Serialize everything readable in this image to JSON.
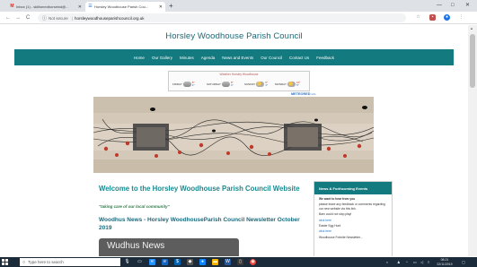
{
  "browser": {
    "tabs": [
      {
        "title": "Inbox (1) - skillsmedhorseind@...",
        "icon": "gmail-icon"
      },
      {
        "title": "Horsley Woodhouse Parish Cou...",
        "icon": "site-icon"
      }
    ],
    "new_tab": "+",
    "window_controls": {
      "minimize": "—",
      "maximize": "□",
      "close": "✕"
    },
    "nav": {
      "back": "←",
      "forward": "→",
      "reload": "C"
    },
    "address": {
      "security": "Not secure",
      "url": "horsleywoodhouseparishcouncil.org.uk"
    }
  },
  "site": {
    "title": "Horsley Woodhouse Parish Council",
    "nav": [
      "Home",
      "Our Gallery",
      "Minutes",
      "Agenda",
      "News and Events",
      "Our Council",
      "Contact Us",
      "Feedback"
    ]
  },
  "weather": {
    "title": "Weather Horsley Woodhouse",
    "days": [
      {
        "name": "FRIDAY",
        "hi": "8°",
        "lo": "4°"
      },
      {
        "name": "SATURDAY",
        "hi": "8°",
        "lo": "4°"
      },
      {
        "name": "SUNDAY",
        "hi": "6°",
        "lo": "1°"
      },
      {
        "name": "MONDAY",
        "hi": "10°",
        "lo": "5°"
      }
    ],
    "brand": "METEORED",
    "brand_suffix": "info"
  },
  "main": {
    "welcome": "Welcome to the Horsley Woodhouse Parish Council Website",
    "motto": "\"taking care of our local community\"",
    "news_heading": "Woodhus News - Horsley WoodhouseParish Council Newsletter October 2019",
    "news_image_text": "Wudhus News"
  },
  "sidebar": {
    "title": "News & Forthcoming Events",
    "lines": [
      "We want to hear from you",
      "please leave any feedback or comments regarding our new website via this link.",
      "Barn could not stop play!",
      "click here",
      "Easter Egg Hunt",
      "click here",
      "Woodhouse Fortnite Newsletter..."
    ]
  },
  "taskbar": {
    "search_placeholder": "Type here to search",
    "time": "08:21",
    "date": "22/11/2019"
  }
}
